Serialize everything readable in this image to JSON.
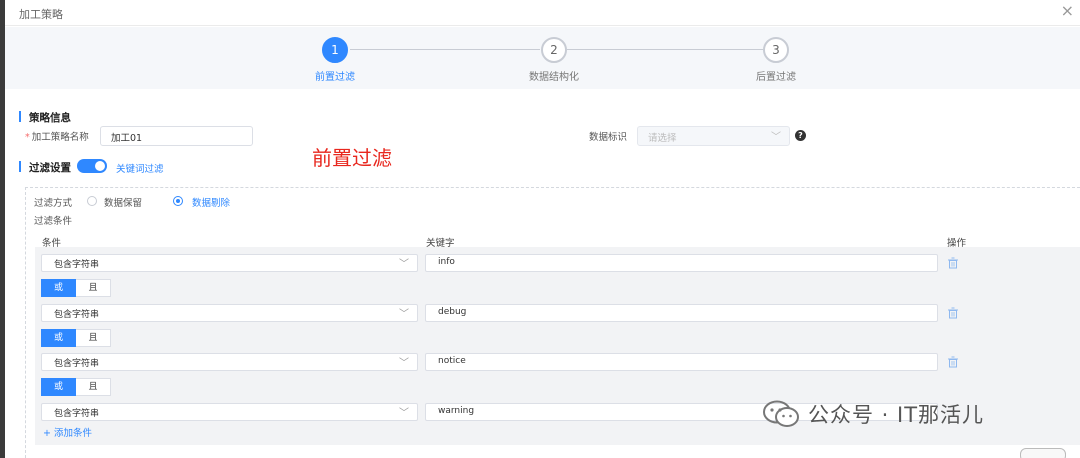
{
  "window": {
    "title": "加工策略"
  },
  "steps": [
    {
      "num": "1",
      "label": "前置过滤",
      "active": true
    },
    {
      "num": "2",
      "label": "数据结构化",
      "active": false
    },
    {
      "num": "3",
      "label": "后置过滤",
      "active": false
    }
  ],
  "strategy": {
    "section_title": "策略信息",
    "name_label": "加工策略名称",
    "name_required_mark": "*",
    "name_value": "加工01",
    "data_tag_label": "数据标识",
    "data_tag_placeholder": "请选择"
  },
  "annotation": "前置过滤",
  "filter": {
    "section_title": "过滤设置",
    "toggle_on": true,
    "keyword_filter_link": "关键词过滤",
    "mode_label": "过滤方式",
    "mode_options": [
      "数据保留",
      "数据剔除"
    ],
    "mode_selected": "数据剔除",
    "conditions_label": "过滤条件",
    "columns": {
      "condition": "条件",
      "keyword": "关键字",
      "actions": "操作"
    },
    "rows": [
      {
        "condition": "包含字符串",
        "keyword": "info"
      },
      {
        "condition": "包含字符串",
        "keyword": "debug"
      },
      {
        "condition": "包含字符串",
        "keyword": "notice"
      },
      {
        "condition": "包含字符串",
        "keyword": "warning"
      }
    ],
    "logic_buttons": {
      "or": "或",
      "and": "且",
      "selected": "或"
    },
    "add_condition": "+ 添加条件"
  },
  "watermark": {
    "text": "公众号 · IT那活儿"
  },
  "colors": {
    "accent": "#2f88ff",
    "annotation": "#e8271e",
    "panel_bg": "#f2f3f5"
  }
}
